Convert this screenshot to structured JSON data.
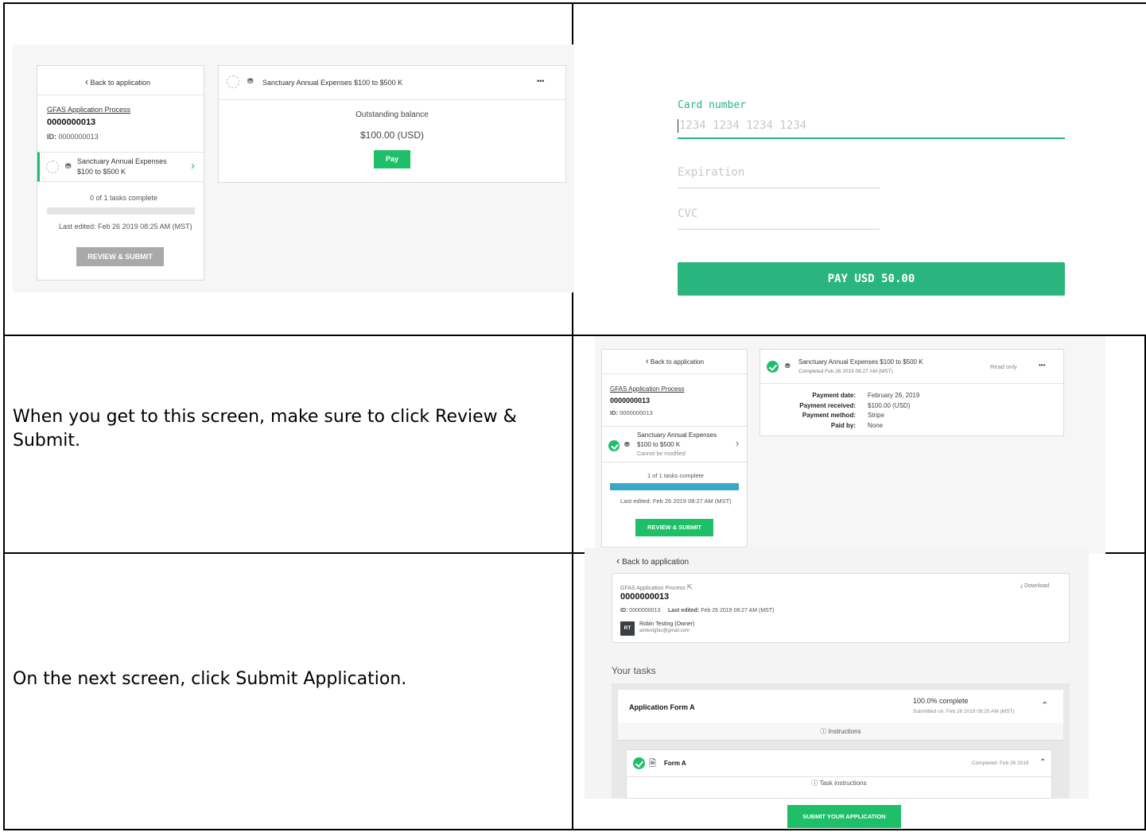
{
  "row1_left": {
    "back_label": "Back to application",
    "process_link": "GFAS Application Process",
    "app_number": "0000000013",
    "id_label": "ID:",
    "id_value": "0000000013",
    "task_name_line1": "Sanctuary Annual Expenses",
    "task_name_line2": "$100 to $500 K",
    "tasks_complete": "0 of 1 tasks complete",
    "progress": 0,
    "last_edited": "Last edited: Feb 26 2019 08:25 AM (MST)",
    "review_submit": "REVIEW & SUBMIT",
    "card_title": "Sanctuary Annual Expenses $100 to $500 K",
    "more_label": "•••",
    "outstanding_label": "Outstanding balance",
    "amount": "$100.00 (USD)",
    "pay_label": "Pay"
  },
  "row1_right": {
    "card_number_label": "Card number",
    "card_number_placeholder": "1234 1234 1234 1234",
    "expiration_placeholder": "Expiration",
    "cvc_placeholder": "CVC",
    "pay_button": "PAY USD 50.00",
    "accent": "#2bb57e"
  },
  "row2_left": {
    "instruction": "When you get to this screen, make sure to click Review & Submit."
  },
  "row2_right": {
    "back_label": "Back to application",
    "process_link": "GFAS Application Process",
    "app_number": "0000000013",
    "id_label": "ID:",
    "id_value": "0000000013",
    "task_name_line1": "Sanctuary Annual Expenses",
    "task_name_line2": "$100 to $500 K",
    "cannot_modify": "Cannot be modified",
    "tasks_complete": "1 of 1 tasks complete",
    "progress": 1,
    "last_edited": "Last edited: Feb 26 2019 08:27 AM (MST)",
    "review_submit": "REVIEW & SUBMIT",
    "card_title": "Sanctuary Annual Expenses $100 to $500 K",
    "completed_on": "Completed Feb 26 2019 08:27 AM (MST)",
    "read_only": "Read only",
    "more_label": "•••",
    "payment_date_label": "Payment date:",
    "payment_date_value": "February 26, 2019",
    "payment_received_label": "Payment received:",
    "payment_received_value": "$100.00 (USD)",
    "payment_method_label": "Payment method:",
    "payment_method_value": "Stripe",
    "paid_by_label": "Paid by:",
    "paid_by_value": "None",
    "progress_color": "#3aa7c9"
  },
  "row3_left": {
    "instruction": "On the next screen, click Submit Application."
  },
  "row3_right": {
    "back_label": "Back to application",
    "process_link": "GFAS Application Process",
    "download_label": "Download",
    "app_number": "0000000013",
    "id_label": "ID:",
    "id_value": "0000000013",
    "last_edited_label": "Last edited:",
    "last_edited_value": "Feb 26 2019 08:27 AM (MST)",
    "avatar_initials": "RT",
    "owner_name": "Robin Testing (Owner)",
    "owner_email": "amtestgfas@gmail.com",
    "your_tasks": "Your tasks",
    "form_title": "Application Form A",
    "form_progress": "100.0% complete",
    "submitted_on": "Submitted on: Feb 26 2019 08:20 AM (MST)",
    "instructions": "Instructions",
    "sub_form": "Form A",
    "sub_completed": "Completed: Feb 26 2019",
    "task_instructions": "Task instructions",
    "submit_button": "SUBMIT YOUR APPLICATION"
  }
}
